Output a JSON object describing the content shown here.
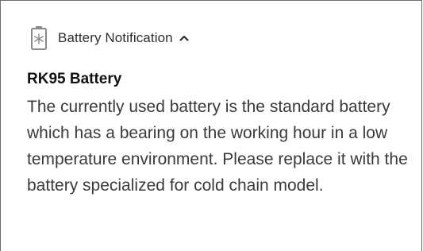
{
  "notification": {
    "app_icon": "battery-cold-icon",
    "app_label": "Battery Notification",
    "expand_icon": "chevron-up-icon",
    "title": "RK95 Battery",
    "body": "The currently used battery is the standard battery which has a bearing on the working hour in a low temperature environment. Please replace it with the battery specialized for cold chain model."
  },
  "colors": {
    "border": "#6f6f6f",
    "icon": "#8a8a8a",
    "title": "#111111",
    "body": "#3a3a3a"
  }
}
